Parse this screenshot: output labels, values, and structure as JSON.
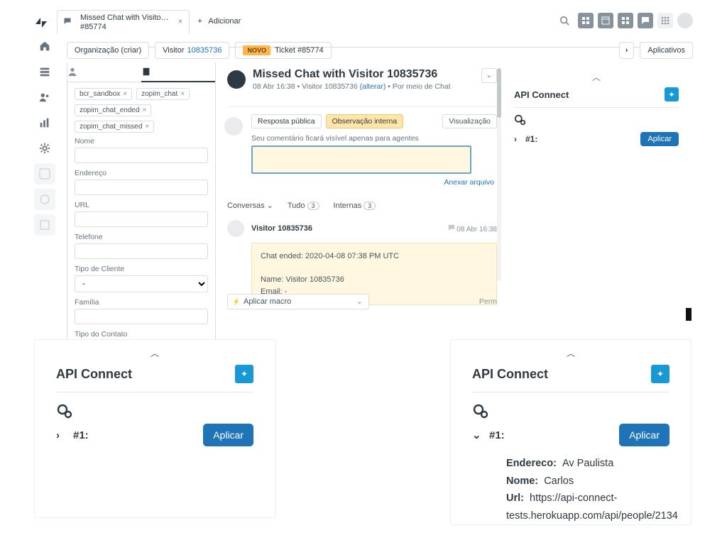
{
  "tab": {
    "title": "Missed Chat with Visito…",
    "subtitle": "#85774",
    "add_label": "Adicionar"
  },
  "crumbs": {
    "org": "Organização (criar)",
    "visitor_label": "Visitor",
    "visitor_id": "10835736",
    "novo": "NOVO",
    "ticket": "Ticket #85774",
    "apps_btn": "Aplicativos"
  },
  "tags": [
    "bcr_sandbox",
    "zopim_chat",
    "zopim_chat_ended",
    "zopim_chat_missed"
  ],
  "fields": {
    "nome": "Nome",
    "endereco": "Endereço",
    "url": "URL",
    "telefone": "Telefone",
    "tipo_cliente": "Tipo de Cliente",
    "tipo_cliente_value": "-",
    "familia": "Família",
    "tipo_contato": "Tipo do Contato"
  },
  "ticket": {
    "title": "Missed Chat with Visitor 10835736",
    "meta_date": "08 Abr 16:38",
    "meta_who": "Visitor 10835736",
    "alterar": "(alterar)",
    "via": "Por meio de Chat"
  },
  "compose": {
    "tab_public": "Resposta pública",
    "tab_internal": "Observação interna",
    "preview": "Visualização",
    "internal_hint": "Seu comentário ficará visível apenas para agentes",
    "attach": "Anexar arquivo"
  },
  "conv": {
    "conversas": "Conversas",
    "tudo": "Tudo",
    "tudo_count": "3",
    "internas": "Internas",
    "internas_count": "3"
  },
  "msg": {
    "author": "Visitor 10835736",
    "time": "08 Abr 16:38",
    "line1": "Chat ended: 2020-04-08 07:38 PM UTC",
    "line2": "Name: Visitor 10835736",
    "line3": "Email: -"
  },
  "macro": {
    "label": "Aplicar macro",
    "perm": "Perm"
  },
  "api": {
    "title": "API Connect",
    "item": "#1:",
    "aplicar": "Aplicar"
  },
  "card_right_details": {
    "endereco_k": "Endereco:",
    "endereco_v": "Av Paulista",
    "nome_k": "Nome:",
    "nome_v": "Carlos",
    "url_k": "Url:",
    "url_v": "https://api-connect-tests.herokuapp.com/api/people/2134"
  }
}
